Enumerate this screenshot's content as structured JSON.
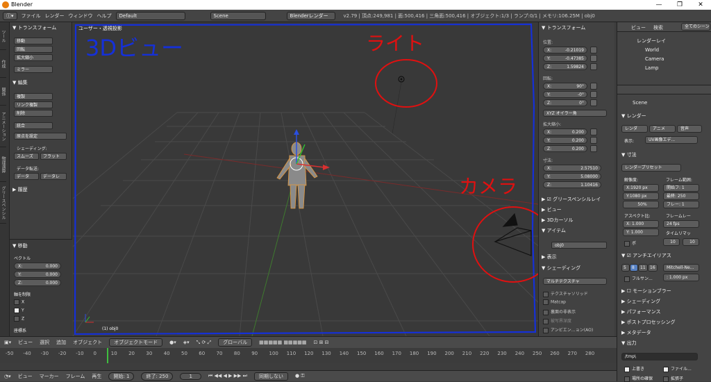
{
  "window": {
    "title": "Blender",
    "min": "—",
    "max": "❐",
    "close": "✕"
  },
  "menubar": {
    "items": [
      "ファイル",
      "レンダー",
      "ウィンドウ",
      "ヘルプ"
    ],
    "layout": "Default",
    "scene": "Scene",
    "engine": "Blenderレンダー",
    "status": "v2.79 | 頂点:249,981 | 面:500,416 | 三角面:500,416 | オブジェクト:1/3 | ランプ:0/1 | メモリ:106.25M | obj0"
  },
  "toolshelf": {
    "tabs": [
      "ツール",
      "作成",
      "関係",
      "アニメーション",
      "物理演算",
      "グリースペンシル"
    ],
    "transform_header": "▼ トランスフォーム",
    "transform_buttons": [
      "移動",
      "回転",
      "拡大縮小",
      "ミラー"
    ],
    "edit_header": "▼ 編集",
    "edit_buttons": [
      "複製",
      "リンク複製",
      "削除",
      "統合"
    ],
    "origin_button": "原点を設定",
    "shading_label": "シェーディング:",
    "smooth": "スムーズ",
    "flat": "フラット",
    "datatransfer_label": "データ転送:",
    "data": "データ",
    "data_l": "データレ",
    "history_header": "▶ 履歴",
    "move_header": "▼ 移動",
    "vector_label": "ベクトル",
    "vx": "X:",
    "vy": "Y:",
    "vz": "Z:",
    "vx_val": "0.000",
    "vy_val": "0.000",
    "vz_val": "0.000",
    "constraint_label": "軸を制限",
    "cx": "X",
    "cy": "Y",
    "cz": "Z",
    "orientation_label": "座標系"
  },
  "viewport": {
    "label": "ユーザー・透視投影",
    "object_label": "(1) obj0",
    "annot_3d": "3Dビュー",
    "annot_light": "ライト",
    "annot_camera": "カメラ"
  },
  "nprops": {
    "transform_header": "▼ トランスフォーム",
    "location_label": "位置:",
    "loc": [
      {
        "k": "X:",
        "v": "-0.21019"
      },
      {
        "k": "Y:",
        "v": "-0.47385"
      },
      {
        "k": "Z:",
        "v": "1.59824"
      }
    ],
    "rotation_label": "回転:",
    "rot": [
      {
        "k": "X:",
        "v": "90°"
      },
      {
        "k": "Y:",
        "v": "-0°"
      },
      {
        "k": "Z:",
        "v": "0°"
      }
    ],
    "rotation_mode": "XYZ オイラー角",
    "scale_label": "拡大縮小:",
    "scale": [
      {
        "k": "X:",
        "v": "0.200"
      },
      {
        "k": "Y:",
        "v": "0.200"
      },
      {
        "k": "Z:",
        "v": "0.200"
      }
    ],
    "dimensions_label": "寸法:",
    "dim": [
      {
        "k": "X:",
        "v": "2.57510"
      },
      {
        "k": "Y:",
        "v": "5.08000"
      },
      {
        "k": "Z:",
        "v": "1.10416"
      }
    ],
    "grease_pencil": "▶ ☑ グリースペンシルレイ",
    "view": "▶ ビュー",
    "cursor": "▶ 3Dカーソル",
    "item": "▼ アイテム",
    "item_name": "obj0",
    "display": "▶ 表示",
    "shading": "▼ シェーディング",
    "shading_mode": "マルチテクスチャ",
    "opt1": "テクスチャソリッド",
    "opt2": "Matcap",
    "opt3": "裏面の非表示",
    "opt4": "被写界深度",
    "opt5": "アンビエン…ョン(AO)"
  },
  "outliner": {
    "view": "ビュー",
    "search": "検索",
    "all_scenes": "全てのシーン",
    "items": [
      "レンダーレイ",
      "World",
      "Camera",
      "Lamp"
    ]
  },
  "properties": {
    "scene": "Scene",
    "render_header": "▼ レンダー",
    "render_btn": "レンダ",
    "anim_btn": "アニメ",
    "audio_btn": "音声",
    "display_label": "表示:",
    "display_val": "UV画像エデ...",
    "dimensions_header": "▼ 寸法",
    "presets": "レンダープリセット",
    "resolution_label": "解像度:",
    "frame_range_label": "フレーム範囲:",
    "res_x": "X:1920 px",
    "res_y": "Y:1080 px",
    "res_pct": "50%",
    "start": "開始フ: 1",
    "end": "最終: 250",
    "step": "フレー: 1",
    "aspect_label": "アスペクト比:",
    "fps_label": "フレームレー",
    "asp_x": "X: 1.000",
    "asp_y": "Y: 1.000",
    "fps": "24 fps",
    "timemap": "タイムリマッ",
    "tm_old": "10",
    "tm_new": "10",
    "border": "ボ",
    "aa_header": "▼ ☑ アンチエイリアス",
    "aa_5": "5",
    "aa_8": "8",
    "aa_11": "11",
    "aa_16": "16",
    "filter": "Mitchell-Ne...",
    "full_sample": "フルサン...",
    "filter_size": ": 1.000 px",
    "motion_blur": "▶ ☐ モーションブラー",
    "shading": "▶ シェーディング",
    "performance": "▶ パフォーマンス",
    "post": "▶ ポストプロセッシング",
    "metadata": "▶ メタデータ",
    "output": "▼ 出力",
    "path": "/tmp\\",
    "overwrite": "上書き",
    "file": "ファイル...",
    "placeholders": "場所の確保",
    "extension": "拡張子"
  },
  "view3d_header": {
    "items": [
      "ビュー",
      "選択",
      "追加",
      "オブジェクト"
    ],
    "mode": "オブジェクトモード",
    "orientation": "グローバル"
  },
  "timeline": {
    "ticks": [
      "-50",
      "-40",
      "-30",
      "-20",
      "-10",
      "0",
      "10",
      "20",
      "30",
      "40",
      "50",
      "60",
      "70",
      "80",
      "90",
      "100",
      "110",
      "120",
      "130",
      "140",
      "150",
      "160",
      "170",
      "180",
      "190",
      "200",
      "210",
      "220",
      "230",
      "240",
      "250",
      "260",
      "270",
      "280"
    ],
    "items": [
      "ビュー",
      "マーカー",
      "フレーム",
      "再生"
    ],
    "start": "開始:",
    "start_val": "1",
    "end": "終了:",
    "end_val": "250",
    "current": "1",
    "sync": "同期しない"
  },
  "colors": {
    "annot_blue": "#1530d8",
    "annot_red": "#e01010",
    "accent_orange": "#e87d0d"
  }
}
